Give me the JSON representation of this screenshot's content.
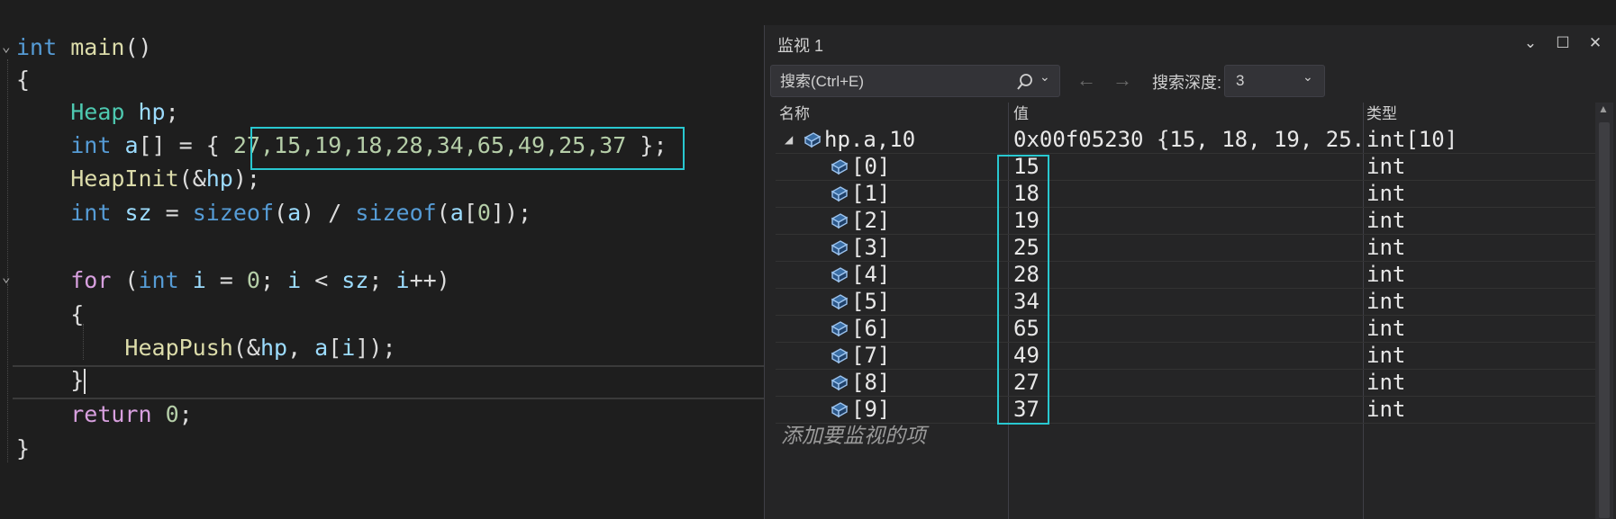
{
  "editor": {
    "lines": {
      "l1": {
        "kw": "int",
        "fn": "main",
        "rest": "()"
      },
      "l2": {
        "text": "{"
      },
      "l3": {
        "ty": "Heap",
        "var": "hp",
        "end": ";"
      },
      "l4": {
        "kw": "int",
        "var": "a",
        "mid": "[] = { ",
        "arr": "27,15,19,18,28,34,65,49,25,37",
        "end": " };"
      },
      "l5": {
        "fn": "HeapInit",
        "p1": "(&",
        "var": "hp",
        "end": ");"
      },
      "l6": {
        "kw": "int",
        "var1": "sz",
        "eq": " = ",
        "fn1": "sizeof",
        "p1": "(",
        "var2": "a",
        "p2": ") / ",
        "fn2": "sizeof",
        "p3": "(",
        "var3": "a",
        "p4": "[",
        "num": "0",
        "p5": "]);"
      },
      "l8": {
        "kw": "for",
        "p1": " (",
        "kw2": "int",
        "var1": " i",
        "p2": " = ",
        "num": "0",
        "p3": "; ",
        "var2": "i",
        "p4": " < ",
        "var3": "sz",
        "p5": "; ",
        "var4": "i",
        "p6": "++)"
      },
      "l9": {
        "text": "{"
      },
      "l10": {
        "fn": "HeapPush",
        "p1": "(&",
        "var1": "hp",
        "p2": ", ",
        "var2": "a",
        "p3": "[",
        "var3": "i",
        "p4": "]);"
      },
      "l11": {
        "text": "}"
      },
      "l12": {
        "kw": "return",
        "num": " 0",
        "end": ";"
      },
      "l13": {
        "text": "}"
      }
    }
  },
  "watch": {
    "title": "监视 1",
    "search_placeholder": "搜索(Ctrl+E)",
    "depth_label": "搜索深度:",
    "depth_value": "3",
    "columns": {
      "name": "名称",
      "value": "值",
      "type": "类型"
    },
    "root": {
      "name": "hp.a,10",
      "value": "0x00f05230 {15, 18, 19, 25...",
      "type": "int[10]"
    },
    "items": [
      {
        "name": "[0]",
        "value": "15",
        "type": "int"
      },
      {
        "name": "[1]",
        "value": "18",
        "type": "int"
      },
      {
        "name": "[2]",
        "value": "19",
        "type": "int"
      },
      {
        "name": "[3]",
        "value": "25",
        "type": "int"
      },
      {
        "name": "[4]",
        "value": "28",
        "type": "int"
      },
      {
        "name": "[5]",
        "value": "34",
        "type": "int"
      },
      {
        "name": "[6]",
        "value": "65",
        "type": "int"
      },
      {
        "name": "[7]",
        "value": "49",
        "type": "int"
      },
      {
        "name": "[8]",
        "value": "27",
        "type": "int"
      },
      {
        "name": "[9]",
        "value": "37",
        "type": "int"
      }
    ],
    "add_item_text": "添加要监视的项",
    "icons": {
      "object": "object-icon",
      "search": "search-icon",
      "close": "close-icon"
    }
  },
  "colors": {
    "highlight": "#29c8d0",
    "keyword": "#569cd6",
    "type": "#4ec9b0",
    "function": "#dcdcaa",
    "number": "#b5cea8"
  }
}
